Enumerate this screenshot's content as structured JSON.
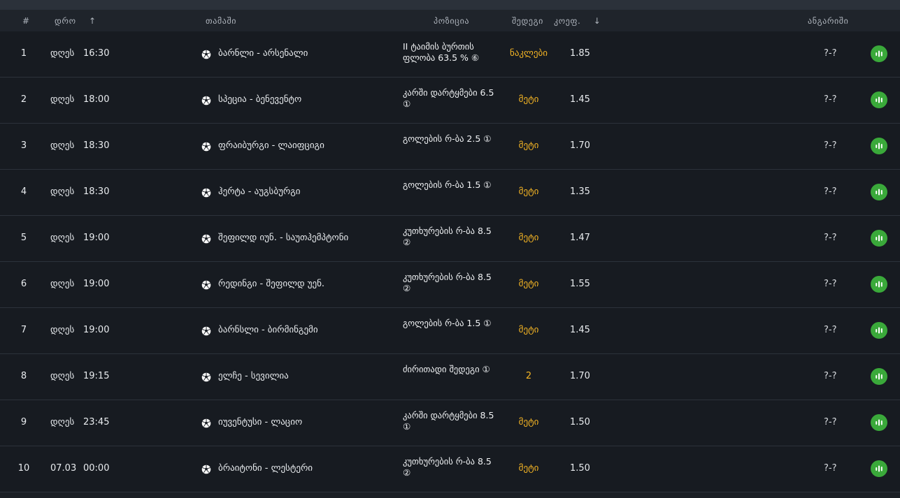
{
  "headers": {
    "index": "#",
    "time": "დრო",
    "game": "თამაში",
    "position": "პოზიცია",
    "bet": "შედეგი",
    "odds": "კოეფ.",
    "score": "ანგარიში"
  },
  "colors": {
    "background": "#171b21",
    "accent": "#f5b524",
    "stats_button": "#3aa93a"
  },
  "rows": [
    {
      "index": "1",
      "day": "დღეს",
      "time": "16:30",
      "game": "ბარნლი - არსენალი",
      "position": "II ტაიმის ბურთის ფლობა 63.5 % ⑥",
      "result": "ნაკლები",
      "odds": "1.85",
      "score": "?-?"
    },
    {
      "index": "2",
      "day": "დღეს",
      "time": "18:00",
      "game": "სპეცია - ბენევენტო",
      "position": "კარში დარტყმები 6.5 ①",
      "result": "მეტი",
      "odds": "1.45",
      "score": "?-?"
    },
    {
      "index": "3",
      "day": "დღეს",
      "time": "18:30",
      "game": "ფრაიბურგი - ლაიფციგი",
      "position": "გოლების რ-ბა 2.5 ①",
      "result": "მეტი",
      "odds": "1.70",
      "score": "?-?"
    },
    {
      "index": "4",
      "day": "დღეს",
      "time": "18:30",
      "game": "ჰერტა - აუგსბურგი",
      "position": "გოლების რ-ბა 1.5 ①",
      "result": "მეტი",
      "odds": "1.35",
      "score": "?-?"
    },
    {
      "index": "5",
      "day": "დღეს",
      "time": "19:00",
      "game": "შეფილდ იუნ. - საუთჰემპტონი",
      "position": "კუთხურების რ-ბა 8.5 ②",
      "result": "მეტი",
      "odds": "1.47",
      "score": "?-?"
    },
    {
      "index": "6",
      "day": "დღეს",
      "time": "19:00",
      "game": "რედინგი - შეფილდ უენ.",
      "position": "კუთხურების რ-ბა 8.5 ②",
      "result": "მეტი",
      "odds": "1.55",
      "score": "?-?"
    },
    {
      "index": "7",
      "day": "დღეს",
      "time": "19:00",
      "game": "ბარნსლი - ბირმინგემი",
      "position": "გოლების რ-ბა 1.5 ①",
      "result": "მეტი",
      "odds": "1.45",
      "score": "?-?"
    },
    {
      "index": "8",
      "day": "დღეს",
      "time": "19:15",
      "game": "ელჩე - სევილია",
      "position": "ძირითადი შედეგი ①",
      "result": "2",
      "odds": "1.70",
      "score": "?-?"
    },
    {
      "index": "9",
      "day": "დღეს",
      "time": "23:45",
      "game": "იუვენტუსი - ლაციო",
      "position": "კარში დარტყმები 8.5 ①",
      "result": "მეტი",
      "odds": "1.50",
      "score": "?-?"
    },
    {
      "index": "10",
      "day": "07.03",
      "time": "00:00",
      "game": "ბრაიტონი - ლესტერი",
      "position": "კუთხურების რ-ბა 8.5 ②",
      "result": "მეტი",
      "odds": "1.50",
      "score": "?-?"
    }
  ]
}
